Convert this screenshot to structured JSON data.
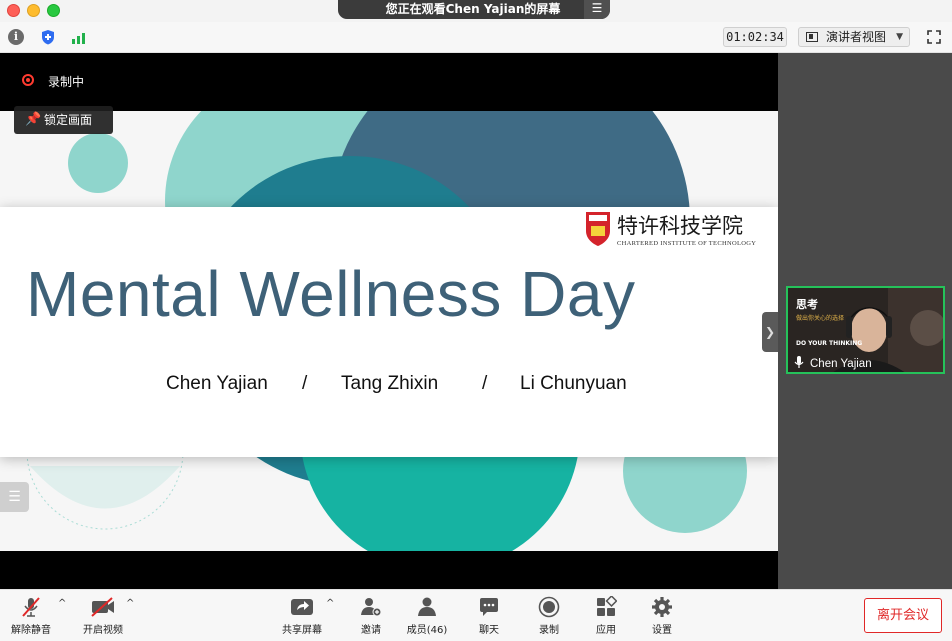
{
  "window": {
    "share_banner": "您正在观看Chen Yajian的屏幕"
  },
  "topbar": {
    "timer": "01:02:34",
    "view_mode": "演讲者视图",
    "icons": [
      "info-icon",
      "shield-icon",
      "signal-icon",
      "fullscreen-icon"
    ]
  },
  "stage": {
    "recording_label": "录制中",
    "lock_label": "锁定画面"
  },
  "slide": {
    "title": "Mental Wellness Day",
    "logo_cn": "特许科技学院",
    "logo_en": "CHARTERED INSTITUTE OF TECHNOLOGY",
    "authors": [
      "Chen Yajian",
      "/",
      "Tang Zhixin",
      "/",
      "Li Chunyuan"
    ]
  },
  "participant": {
    "name": "Chen Yajian",
    "caption_title": "思考",
    "caption_sub": "做出你关心的选择",
    "caption_en": "DO YOUR THINKING"
  },
  "bottombar": {
    "unmute": "解除静音",
    "start_video": "开启视频",
    "share_screen": "共享屏幕",
    "invite": "邀请",
    "participants": "成员(46)",
    "chat": "聊天",
    "record": "录制",
    "apps": "应用",
    "settings": "设置",
    "leave": "离开会议"
  },
  "colors": {
    "accent_green": "#25c25a",
    "leave_red": "#e02828",
    "title_blue": "#3e6178",
    "teal_light": "#8fd5cc",
    "teal_dark": "#1f7d8f",
    "teal_green": "#16b3a2"
  }
}
